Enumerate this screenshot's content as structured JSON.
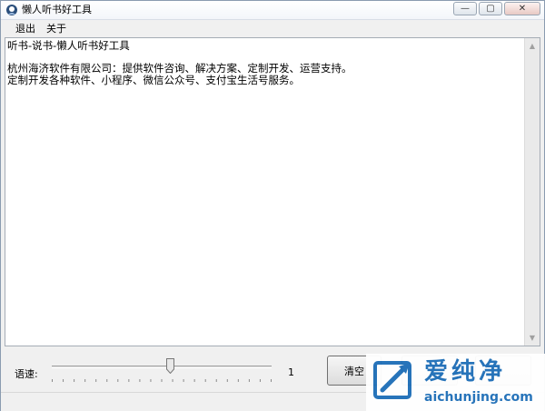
{
  "window": {
    "title": "懒人听书好工具",
    "minimize_glyph": "—",
    "maximize_glyph": "▢",
    "close_glyph": "✕"
  },
  "menu": {
    "items": [
      {
        "label": "退出"
      },
      {
        "label": "关于"
      }
    ]
  },
  "editor": {
    "text": "听书-说书-懒人听书好工具\n\n杭州海济软件有限公司：提供软件咨询、解决方案、定制开发、运营支持。\n定制开发各种软件、小程序、微信公众号、支付宝生活号服务。"
  },
  "controls": {
    "speed_label": "语速:",
    "speed_value": "1",
    "slider_level": 0.54,
    "clear_button": "清空",
    "button_2": "",
    "button_3": ""
  },
  "watermark": {
    "brand": "爱纯净",
    "domain": "aichunjing.com",
    "color": "#1f6fb8"
  }
}
